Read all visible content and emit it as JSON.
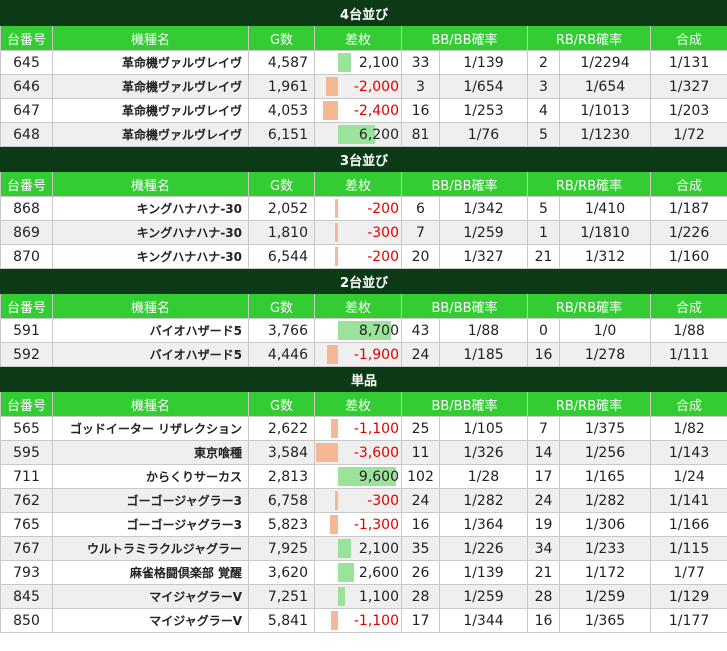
{
  "columns": [
    "台番号",
    "機種名",
    "G数",
    "差枚",
    "BB/BB確率",
    "",
    "RB/RB確率",
    "",
    "合成"
  ],
  "groups": [
    {
      "title": "4台並び",
      "rows": [
        {
          "no": "645",
          "name": "革命機ヴァルヴレイヴ",
          "g": "4,587",
          "sa": "2,100",
          "sa_value": 2100,
          "bb": "33",
          "bbp": "1/139",
          "rb": "2",
          "rbp": "1/2294",
          "total": "1/131"
        },
        {
          "no": "646",
          "name": "革命機ヴァルヴレイヴ",
          "g": "1,961",
          "sa": "-2,000",
          "sa_value": -2000,
          "bb": "3",
          "bbp": "1/654",
          "rb": "3",
          "rbp": "1/654",
          "total": "1/327"
        },
        {
          "no": "647",
          "name": "革命機ヴァルヴレイヴ",
          "g": "4,053",
          "sa": "-2,400",
          "sa_value": -2400,
          "bb": "16",
          "bbp": "1/253",
          "rb": "4",
          "rbp": "1/1013",
          "total": "1/203"
        },
        {
          "no": "648",
          "name": "革命機ヴァルヴレイヴ",
          "g": "6,151",
          "sa": "6,200",
          "sa_value": 6200,
          "bb": "81",
          "bbp": "1/76",
          "rb": "5",
          "rbp": "1/1230",
          "total": "1/72"
        }
      ]
    },
    {
      "title": "3台並び",
      "rows": [
        {
          "no": "868",
          "name": "キングハナハナ-30",
          "g": "2,052",
          "sa": "-200",
          "sa_value": -200,
          "bb": "6",
          "bbp": "1/342",
          "rb": "5",
          "rbp": "1/410",
          "total": "1/187"
        },
        {
          "no": "869",
          "name": "キングハナハナ-30",
          "g": "1,810",
          "sa": "-300",
          "sa_value": -300,
          "bb": "7",
          "bbp": "1/259",
          "rb": "1",
          "rbp": "1/1810",
          "total": "1/226"
        },
        {
          "no": "870",
          "name": "キングハナハナ-30",
          "g": "6,544",
          "sa": "-200",
          "sa_value": -200,
          "bb": "20",
          "bbp": "1/327",
          "rb": "21",
          "rbp": "1/312",
          "total": "1/160"
        }
      ]
    },
    {
      "title": "2台並び",
      "rows": [
        {
          "no": "591",
          "name": "バイオハザード5",
          "g": "3,766",
          "sa": "8,700",
          "sa_value": 8700,
          "bb": "43",
          "bbp": "1/88",
          "rb": "0",
          "rbp": "1/0",
          "total": "1/88"
        },
        {
          "no": "592",
          "name": "バイオハザード5",
          "g": "4,446",
          "sa": "-1,900",
          "sa_value": -1900,
          "bb": "24",
          "bbp": "1/185",
          "rb": "16",
          "rbp": "1/278",
          "total": "1/111"
        }
      ]
    },
    {
      "title": "単品",
      "rows": [
        {
          "no": "565",
          "name": "ゴッドイーター リザレクション",
          "g": "2,622",
          "sa": "-1,100",
          "sa_value": -1100,
          "bb": "25",
          "bbp": "1/105",
          "rb": "7",
          "rbp": "1/375",
          "total": "1/82"
        },
        {
          "no": "595",
          "name": "東京喰種",
          "g": "3,584",
          "sa": "-3,600",
          "sa_value": -3600,
          "bb": "11",
          "bbp": "1/326",
          "rb": "14",
          "rbp": "1/256",
          "total": "1/143"
        },
        {
          "no": "711",
          "name": "からくりサーカス",
          "g": "2,813",
          "sa": "9,600",
          "sa_value": 9600,
          "bb": "102",
          "bbp": "1/28",
          "rb": "17",
          "rbp": "1/165",
          "total": "1/24"
        },
        {
          "no": "762",
          "name": "ゴーゴージャグラー3",
          "g": "6,758",
          "sa": "-300",
          "sa_value": -300,
          "bb": "24",
          "bbp": "1/282",
          "rb": "24",
          "rbp": "1/282",
          "total": "1/141"
        },
        {
          "no": "765",
          "name": "ゴーゴージャグラー3",
          "g": "5,823",
          "sa": "-1,300",
          "sa_value": -1300,
          "bb": "16",
          "bbp": "1/364",
          "rb": "19",
          "rbp": "1/306",
          "total": "1/166"
        },
        {
          "no": "767",
          "name": "ウルトラミラクルジャグラー",
          "g": "7,925",
          "sa": "2,100",
          "sa_value": 2100,
          "bb": "35",
          "bbp": "1/226",
          "rb": "34",
          "rbp": "1/233",
          "total": "1/115"
        },
        {
          "no": "793",
          "name": "麻雀格闘倶楽部 覚醒",
          "g": "3,620",
          "sa": "2,600",
          "sa_value": 2600,
          "bb": "26",
          "bbp": "1/139",
          "rb": "21",
          "rbp": "1/172",
          "total": "1/77"
        },
        {
          "no": "845",
          "name": "マイジャグラーV",
          "g": "7,251",
          "sa": "1,100",
          "sa_value": 1100,
          "bb": "28",
          "bbp": "1/259",
          "rb": "28",
          "rbp": "1/259",
          "total": "1/129"
        },
        {
          "no": "850",
          "name": "マイジャグラーV",
          "g": "5,841",
          "sa": "-1,100",
          "sa_value": -1100,
          "bb": "17",
          "bbp": "1/344",
          "rb": "16",
          "rbp": "1/365",
          "total": "1/177"
        }
      ]
    }
  ]
}
